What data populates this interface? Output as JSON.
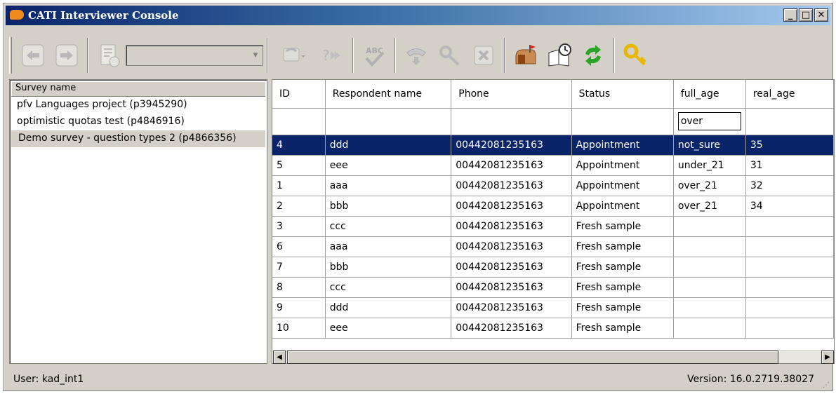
{
  "window": {
    "title": "CATI Interviewer Console",
    "minimize": "_",
    "maximize": "□",
    "close": "✕"
  },
  "toolbar": {
    "combo_value": "",
    "buttons": [
      "back-icon",
      "forward-icon",
      "history-icon",
      "call-icon",
      "skip-icon",
      "spellcheck-icon",
      "hangup-icon",
      "key-icon",
      "cancel-icon",
      "mailbox-icon",
      "appointment-icon",
      "refresh-icon",
      "login-key-icon"
    ]
  },
  "survey_list": {
    "header": "Survey name",
    "items": [
      "pfv Languages project (p3945290)",
      "optimistic quotas test (p4846916)",
      "Demo survey - question types 2 (p4866356)"
    ],
    "selected_index": 2
  },
  "grid": {
    "columns": [
      "ID",
      "Respondent name",
      "Phone",
      "Status",
      "full_age",
      "real_age"
    ],
    "filter": {
      "full_age": "over"
    },
    "rows": [
      [
        "4",
        "ddd",
        "00442081235163",
        "Appointment",
        "not_sure",
        "35"
      ],
      [
        "5",
        "eee",
        "00442081235163",
        "Appointment",
        "under_21",
        "31"
      ],
      [
        "1",
        "aaa",
        "00442081235163",
        "Appointment",
        "over_21",
        "32"
      ],
      [
        "2",
        "bbb",
        "00442081235163",
        "Appointment",
        "over_21",
        "34"
      ],
      [
        "3",
        "ccc",
        "00442081235163",
        "Fresh sample",
        "",
        ""
      ],
      [
        "6",
        "aaa",
        "00442081235163",
        "Fresh sample",
        "",
        ""
      ],
      [
        "7",
        "bbb",
        "00442081235163",
        "Fresh sample",
        "",
        ""
      ],
      [
        "8",
        "ccc",
        "00442081235163",
        "Fresh sample",
        "",
        ""
      ],
      [
        "9",
        "ddd",
        "00442081235163",
        "Fresh sample",
        "",
        ""
      ],
      [
        "10",
        "eee",
        "00442081235163",
        "Fresh sample",
        "",
        ""
      ]
    ],
    "selected_index": 0
  },
  "status": {
    "user": "User:  kad_int1",
    "version": "Version:  16.0.2719.38027"
  },
  "colors": {
    "selection": "#0a246a",
    "chrome": "#d4d0c8",
    "title_start": "#0a246a",
    "title_end": "#a6caf0"
  }
}
